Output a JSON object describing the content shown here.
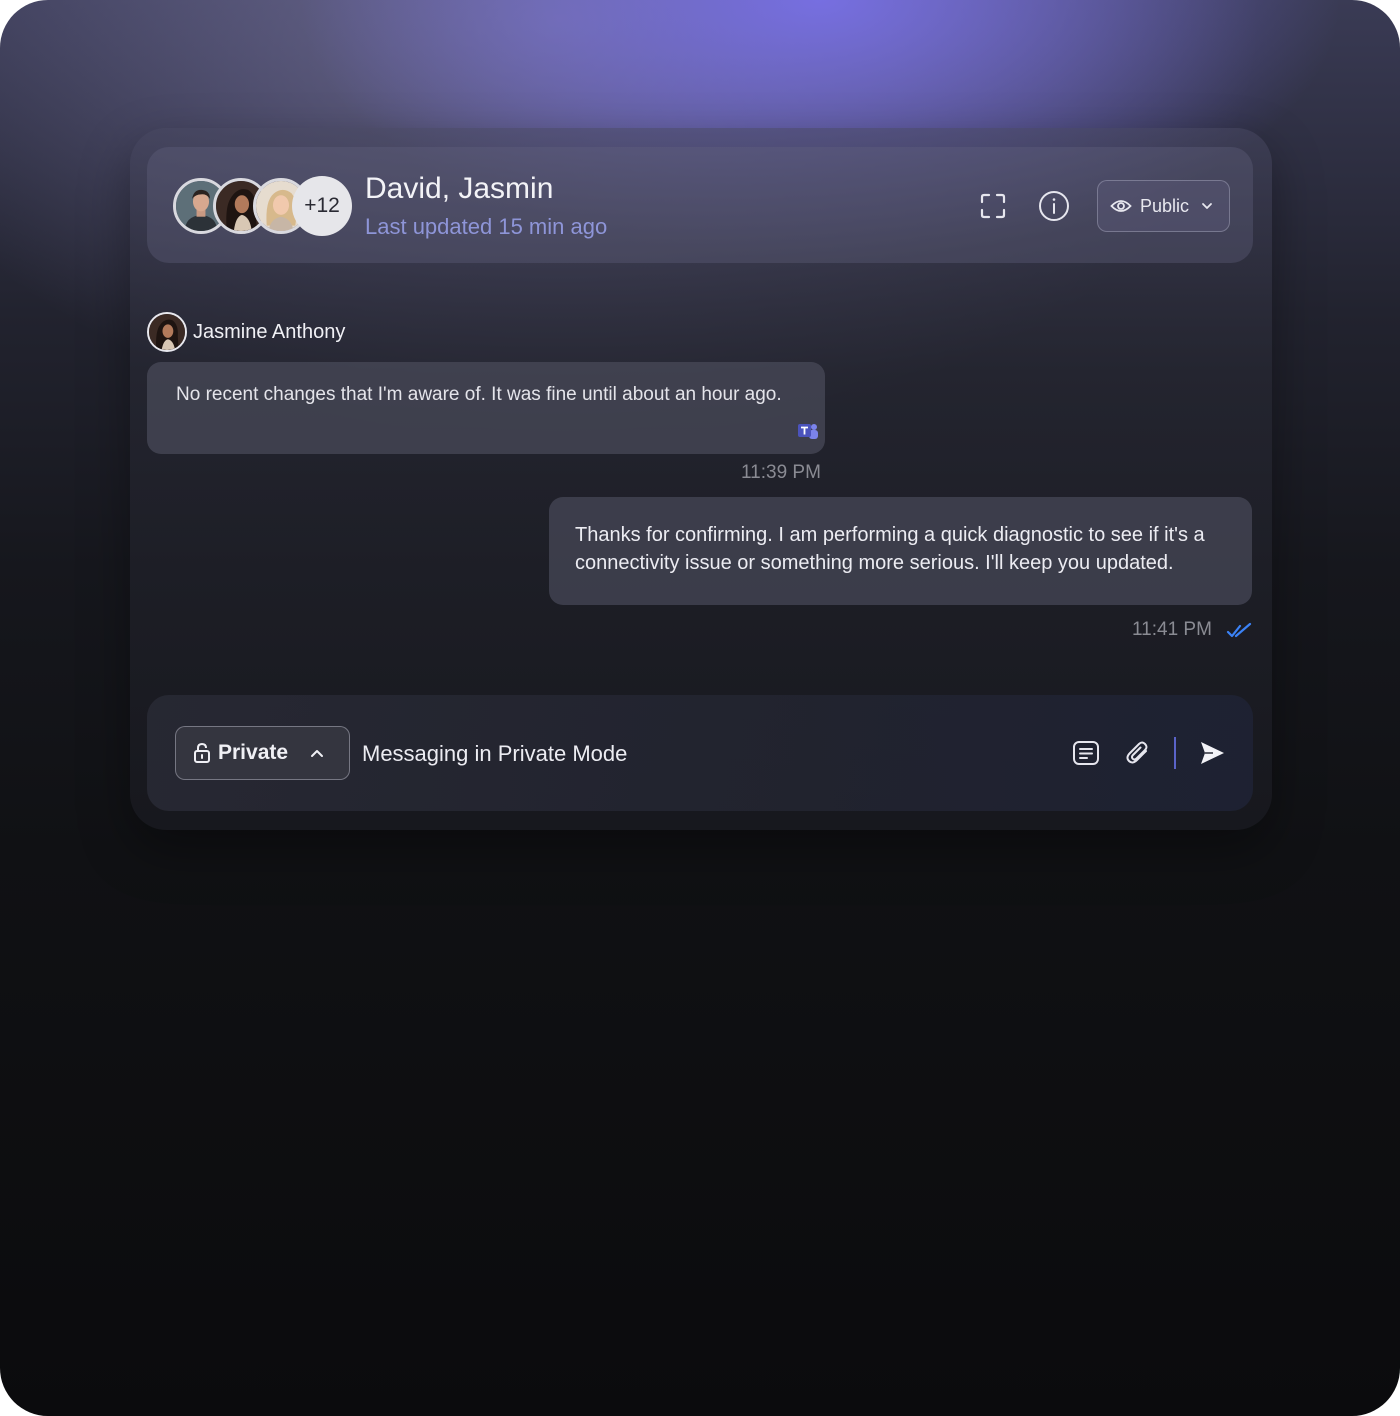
{
  "header": {
    "title": "David, Jasmin",
    "subtitle": "Last updated 15 min ago",
    "extra_participants": "+12",
    "visibility_label": "Public",
    "participants": [
      "avatar-david",
      "avatar-jasmine",
      "avatar-woman-blonde"
    ],
    "icons": [
      "fullscreen-icon",
      "info-icon",
      "eye-icon",
      "chevron-down-icon"
    ]
  },
  "messages": [
    {
      "direction": "incoming",
      "sender": "Jasmine Anthony",
      "text": "No recent changes that I'm aware of. It was fine until about an hour ago.",
      "time": "11:39 PM",
      "source_icon": "teams-icon"
    },
    {
      "direction": "outgoing",
      "text": "Thanks for confirming. I am performing a quick diagnostic to see if it's a connectivity issue or something more serious. I'll keep you updated.",
      "time": "11:41 PM",
      "status_icon": "double-check-icon"
    }
  ],
  "composer": {
    "mode_label": "Private",
    "placeholder": "Messaging in Private Mode",
    "value": "",
    "icons": [
      "lock-icon",
      "chevron-up-icon",
      "notes-icon",
      "paperclip-icon",
      "send-icon"
    ]
  },
  "colors": {
    "accent": "#8e95d8",
    "read_receipt": "#3b82f6",
    "divider": "#5a63c8",
    "glow": "#7870e6"
  }
}
